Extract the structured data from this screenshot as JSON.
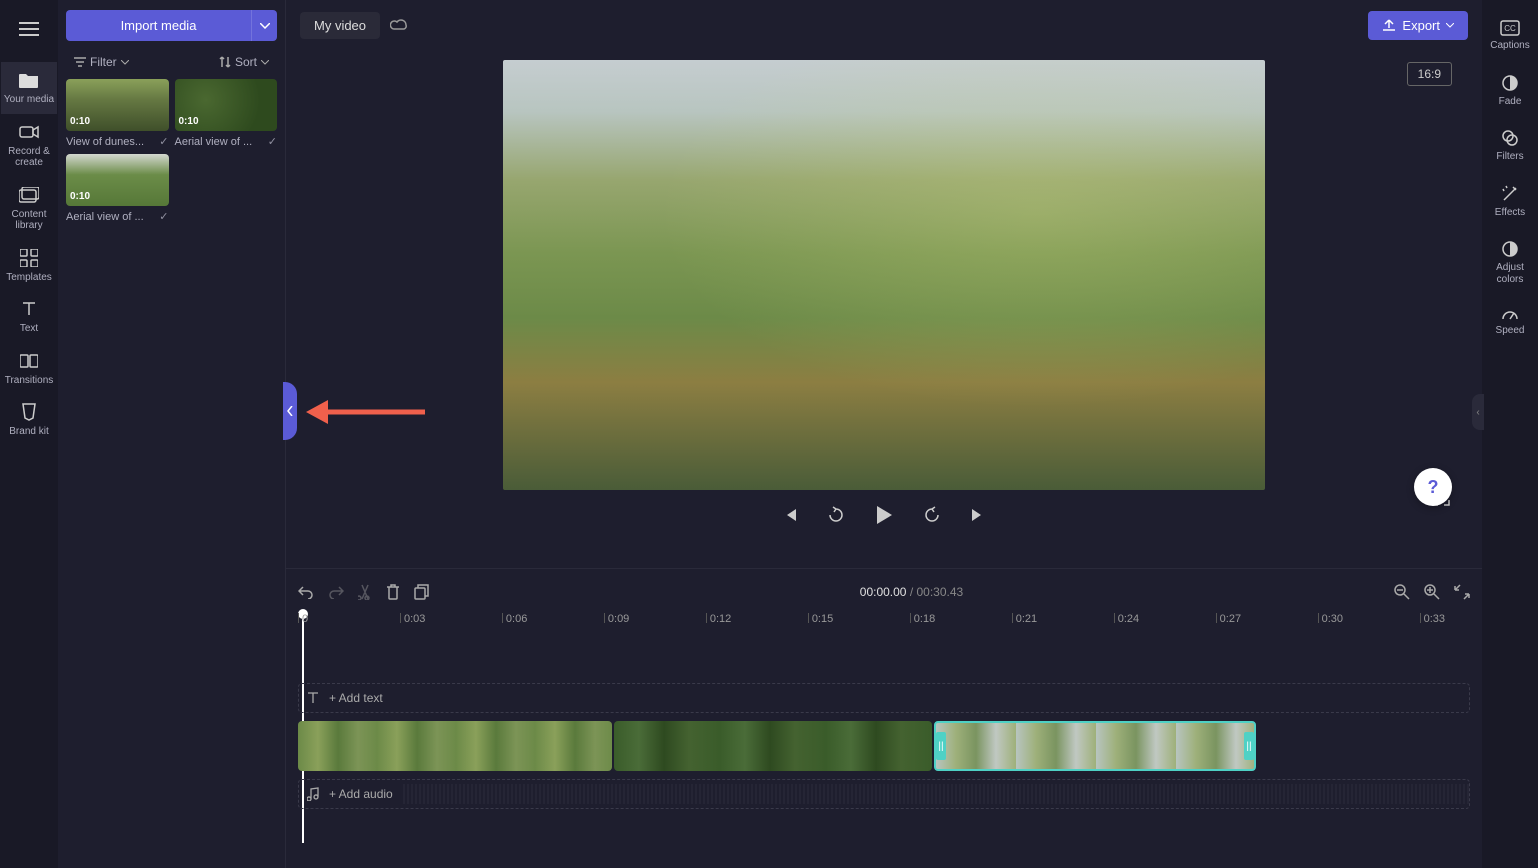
{
  "leftNav": {
    "items": [
      {
        "label": "Your media"
      },
      {
        "label": "Record & create"
      },
      {
        "label": "Content library"
      },
      {
        "label": "Templates"
      },
      {
        "label": "Text"
      },
      {
        "label": "Transitions"
      },
      {
        "label": "Brand kit"
      }
    ]
  },
  "mediaPanel": {
    "importLabel": "Import media",
    "filterLabel": "Filter",
    "sortLabel": "Sort",
    "items": [
      {
        "duration": "0:10",
        "name": "View of dunes..."
      },
      {
        "duration": "0:10",
        "name": "Aerial view of ..."
      },
      {
        "duration": "0:10",
        "name": "Aerial view of ..."
      }
    ]
  },
  "header": {
    "title": "My video",
    "exportLabel": "Export",
    "aspectRatio": "16:9"
  },
  "timeline": {
    "currentTime": "00:00.00",
    "totalTime": "00:30.43",
    "addText": "+ Add text",
    "addAudio": "+ Add audio",
    "ticks": [
      "0",
      "0:03",
      "0:06",
      "0:09",
      "0:12",
      "0:15",
      "0:18",
      "0:21",
      "0:24",
      "0:27",
      "0:30",
      "0:33"
    ]
  },
  "rightNav": {
    "items": [
      {
        "label": "Captions"
      },
      {
        "label": "Fade"
      },
      {
        "label": "Filters"
      },
      {
        "label": "Effects"
      },
      {
        "label": "Adjust colors"
      },
      {
        "label": "Speed"
      }
    ]
  },
  "help": "?"
}
